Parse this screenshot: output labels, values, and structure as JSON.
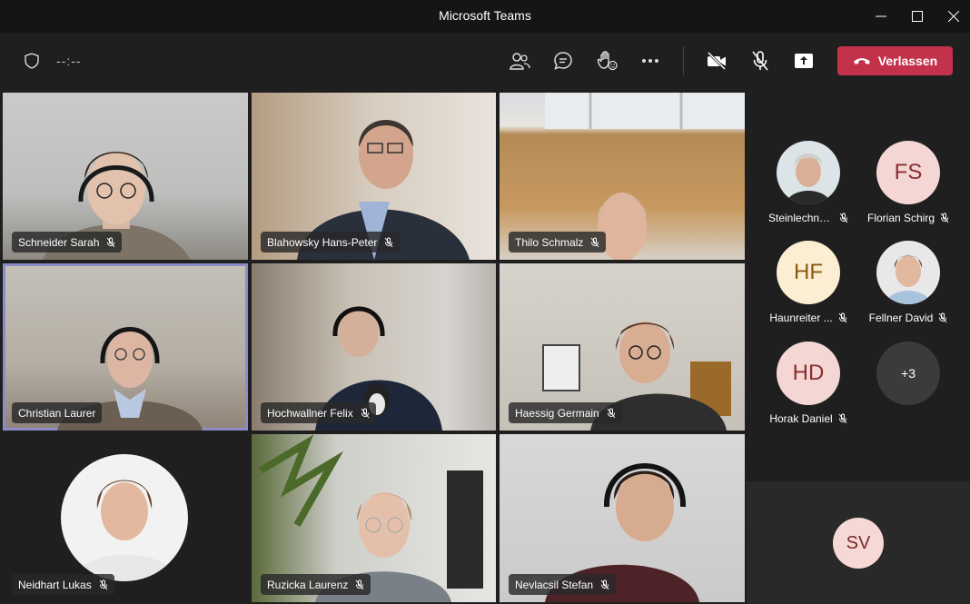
{
  "window": {
    "title": "Microsoft Teams"
  },
  "toolbar": {
    "timer": "--:--",
    "leave_label": "Verlassen"
  },
  "tiles": [
    {
      "name": "Schneider Sarah"
    },
    {
      "name": "Blahowsky Hans-Peter"
    },
    {
      "name": "Thilo Schmalz"
    },
    {
      "name": "Christian Laurer"
    },
    {
      "name": "Hochwallner Felix"
    },
    {
      "name": "Haessig Germain"
    },
    {
      "name": "Neidhart Lukas"
    },
    {
      "name": "Ruzicka Laurenz"
    },
    {
      "name": "Nevlacsil Stefan"
    }
  ],
  "roster": [
    {
      "name": "Steinlechne...",
      "initials": ""
    },
    {
      "name": "Florian Schirg",
      "initials": "FS"
    },
    {
      "name": "Haunreiter ...",
      "initials": "HF"
    },
    {
      "name": "Fellner David",
      "initials": ""
    },
    {
      "name": "Horak Daniel",
      "initials": "HD"
    },
    {
      "name": "",
      "initials": "+3"
    }
  ],
  "self": {
    "initials": "SV"
  },
  "colors": {
    "leave": "#c4314b",
    "active_outline": "#8b8cc7"
  }
}
